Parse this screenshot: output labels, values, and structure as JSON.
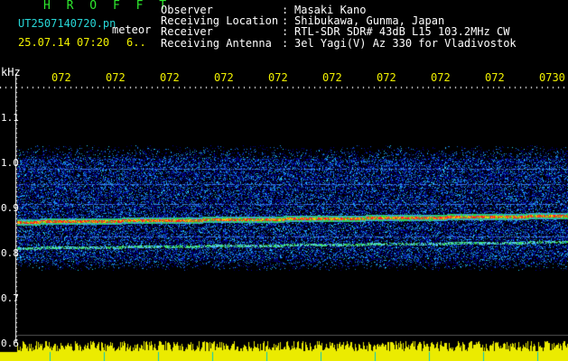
{
  "header": {
    "title": "H R O F F T",
    "filename": "UT2507140720.pn",
    "tag": "meteor",
    "datetime": "25.07.14 07:20",
    "count": "6.."
  },
  "meta": {
    "observer": {
      "label": "Observer",
      "value": "Masaki Kano"
    },
    "location": {
      "label": "Receiving Location",
      "value": "Shibukawa, Gunma, Japan"
    },
    "receiver": {
      "label": "Receiver",
      "value": "RTL-SDR SDR# 43dB L15 103.2MHz CW"
    },
    "antenna": {
      "label": "Receiving Antenna",
      "value": "3el Yagi(V) Az 330 for Vladivostok"
    }
  },
  "axis": {
    "unit": "kHz",
    "time_ticks": [
      "072",
      "072",
      "072",
      "072",
      "072",
      "072",
      "072",
      "072",
      "072",
      "0730"
    ],
    "y_ticks": [
      "1.1",
      "1.0",
      "0.9",
      "0.8",
      "0.7",
      "0.6"
    ]
  },
  "colors": {
    "title": "#2ee82e",
    "file": "#27d7d7",
    "tick": "#f2f200",
    "bg": "#000000"
  }
}
